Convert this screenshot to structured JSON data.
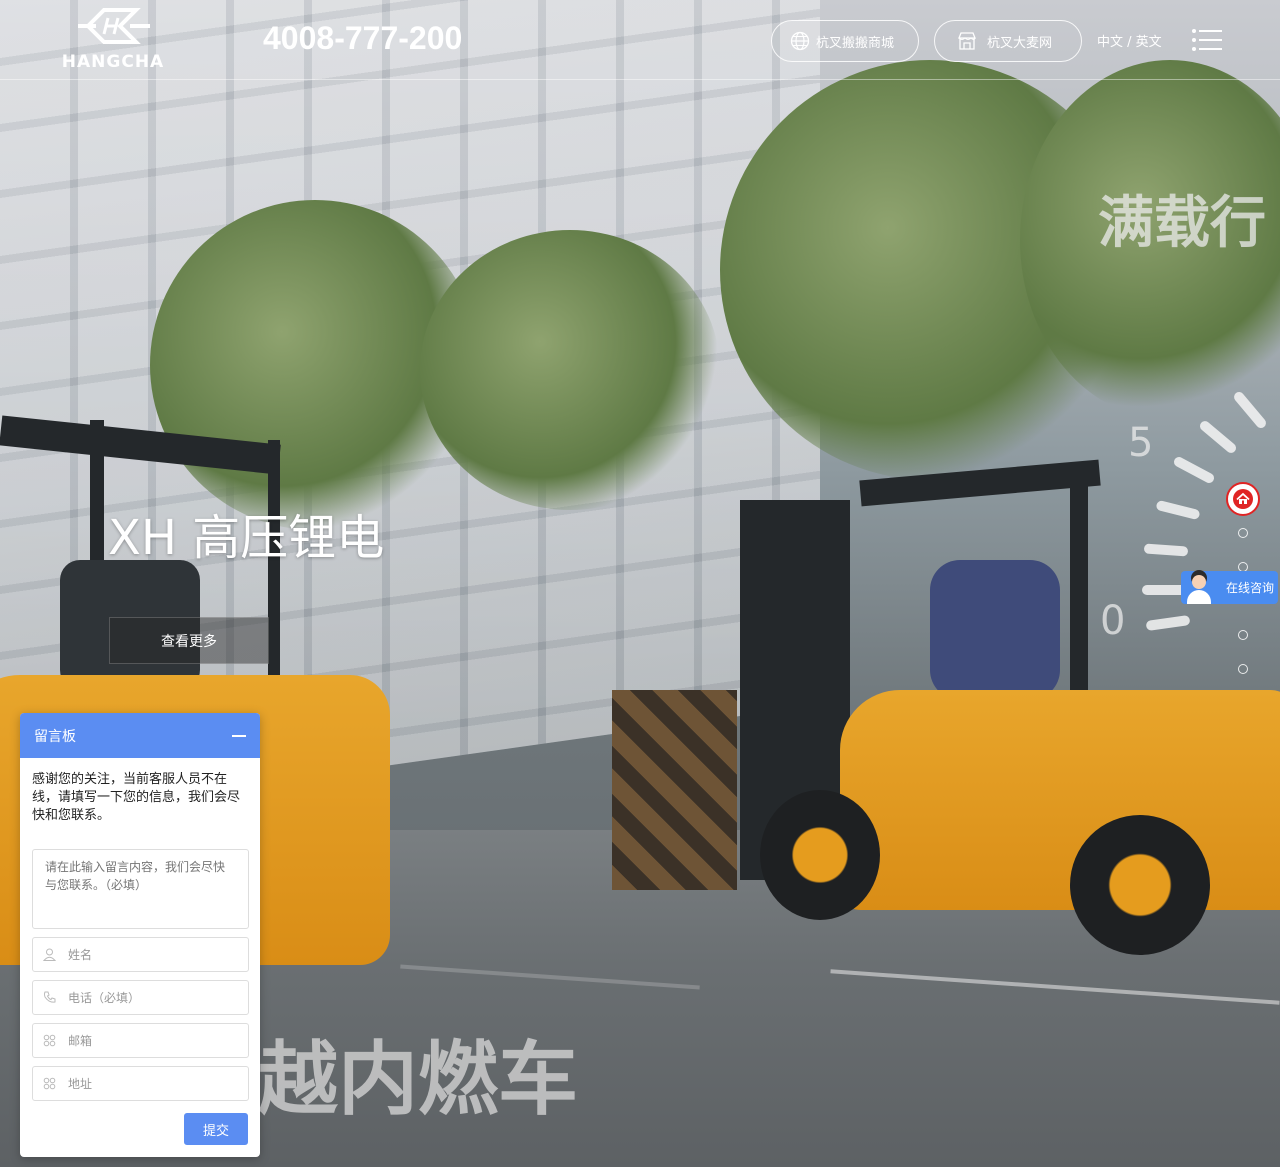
{
  "header": {
    "logo_text": "HANGCHA",
    "phone": "4008-777-200",
    "mall_label": "杭叉搬搬商城",
    "store_label": "杭叉大麦网",
    "lang_label": "中文 / 英文"
  },
  "hero": {
    "title": "XH 高压锂电",
    "more_label": "查看更多",
    "overlay_top": "满载行",
    "overlay_bottom": "越内燃车",
    "gauge_5": "5",
    "gauge_0": "0"
  },
  "side": {
    "consult_label": "在线咨询"
  },
  "message_board": {
    "title": "留言板",
    "intro": "感谢您的关注，当前客服人员不在线，请填写一下您的信息，我们会尽快和您联系。",
    "content_placeholder": "请在此输入留言内容，我们会尽快与您联系。（必填）",
    "name_placeholder": "姓名",
    "phone_placeholder": "电话（必填）",
    "email_placeholder": "邮箱",
    "address_placeholder": "地址",
    "submit_label": "提交"
  },
  "colors": {
    "accent_blue": "#5b8df2",
    "home_red": "#e02424",
    "forklift_orange": "#e8a62c"
  },
  "icons": [
    "globe-icon",
    "store-icon",
    "menu-icon",
    "home-icon",
    "user-icon",
    "phone-icon",
    "grid-icon",
    "minimize-icon"
  ]
}
